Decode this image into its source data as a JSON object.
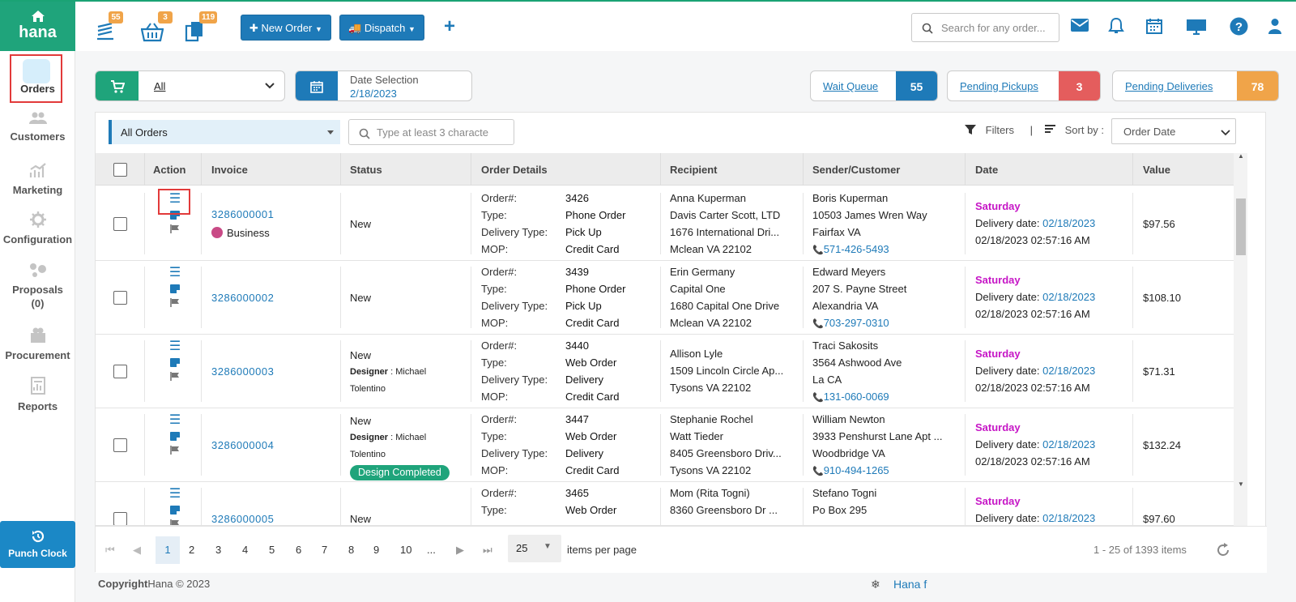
{
  "app": {
    "name": "hana"
  },
  "topbar": {
    "badges": [
      {
        "icon": "stack-icon",
        "count": "55"
      },
      {
        "icon": "basket-icon",
        "count": "3"
      },
      {
        "icon": "copy-icon",
        "count": "119"
      }
    ],
    "new_order": "New Order",
    "dispatch": "Dispatch",
    "search_placeholder": "Search for any order..."
  },
  "sidebar": {
    "items": [
      {
        "label": "Orders",
        "icon": "orders-icon",
        "active": true
      },
      {
        "label": "Customers",
        "icon": "customers-icon"
      },
      {
        "label": "Marketing",
        "icon": "marketing-icon"
      },
      {
        "label": "Configuration",
        "icon": "gear-icon"
      },
      {
        "label": "Proposals",
        "sub": "(0)",
        "icon": "proposals-icon"
      },
      {
        "label": "Procurement",
        "icon": "procurement-icon"
      },
      {
        "label": "Reports",
        "icon": "reports-icon"
      }
    ],
    "punch_clock": "Punch Clock"
  },
  "filters": {
    "store": "All",
    "date_label": "Date Selection",
    "date_value": "2/18/2023",
    "queues": [
      {
        "label": "Wait Queue",
        "count": "55",
        "color": "#1e7ab8"
      },
      {
        "label": "Pending Pickups",
        "count": "3",
        "color": "#e45d5d"
      },
      {
        "label": "Pending Deliveries",
        "count": "78",
        "color": "#f0a449"
      }
    ]
  },
  "grid": {
    "order_filter": "All Orders",
    "search_placeholder": "Type at least 3 characte",
    "filters_label": "Filters",
    "sort_label": "Sort by :",
    "sort_value": "Order Date",
    "columns": [
      "Action",
      "Invoice",
      "Status",
      "Order Details",
      "Recipient",
      "Sender/Customer",
      "Date",
      "Value"
    ],
    "detail_labels": [
      "Order#:",
      "Type:",
      "Delivery Type:",
      "MOP:"
    ],
    "rows": [
      {
        "invoice": "3286000001",
        "tag": "Business",
        "status": "New",
        "designer": "",
        "design_done": "",
        "order_no": "3426",
        "type": "Phone Order",
        "delivery_type": "Pick Up",
        "mop": "Credit Card",
        "recipient": [
          "Anna Kuperman",
          "Davis Carter Scott, LTD",
          "1676 International Dri...",
          "Mclean VA 22102"
        ],
        "sender": [
          "Boris Kuperman",
          "10503 James Wren Way",
          "Fairfax VA"
        ],
        "phone": "571-426-5493",
        "day": "Saturday",
        "delivery_label": "Delivery date:",
        "delivery_date": "02/18/2023",
        "timestamp": "02/18/2023 02:57:16 AM",
        "value": "$97.56"
      },
      {
        "invoice": "3286000002",
        "tag": "",
        "status": "New",
        "designer": "",
        "design_done": "",
        "order_no": "3439",
        "type": "Phone Order",
        "delivery_type": "Pick Up",
        "mop": "Credit Card",
        "recipient": [
          "Erin Germany",
          "Capital One",
          "1680 Capital One Drive",
          "Mclean VA 22102"
        ],
        "sender": [
          "Edward Meyers",
          "207 S. Payne Street",
          "Alexandria VA"
        ],
        "phone": "703-297-0310",
        "day": "Saturday",
        "delivery_label": "Delivery date:",
        "delivery_date": "02/18/2023",
        "timestamp": "02/18/2023 02:57:16 AM",
        "value": "$108.10"
      },
      {
        "invoice": "3286000003",
        "tag": "",
        "status": "New",
        "designer_label": "Designer",
        "designer": "Michael",
        "designer2": "Tolentino",
        "design_done": "",
        "order_no": "3440",
        "type": "Web Order",
        "delivery_type": "Delivery",
        "mop": "Credit Card",
        "recipient": [
          "Allison Lyle",
          "1509 Lincoln Circle Ap...",
          "Tysons VA 22102",
          ""
        ],
        "sender": [
          "Traci Sakosits",
          "3564 Ashwood Ave",
          "La CA"
        ],
        "phone": "131-060-0069",
        "day": "Saturday",
        "delivery_label": "Delivery date:",
        "delivery_date": "02/18/2023",
        "timestamp": "02/18/2023 02:57:16 AM",
        "value": "$71.31"
      },
      {
        "invoice": "3286000004",
        "tag": "",
        "status": "New",
        "designer_label": "Designer",
        "designer": "Michael",
        "designer2": "Tolentino",
        "design_done": "Design Completed",
        "order_no": "3447",
        "type": "Web Order",
        "delivery_type": "Delivery",
        "mop": "Credit Card",
        "recipient": [
          "Stephanie Rochel",
          "Watt Tieder",
          "8405 Greensboro Driv...",
          "Tysons VA 22102"
        ],
        "sender": [
          "William Newton",
          "3933 Penshurst Lane Apt ...",
          "Woodbridge VA"
        ],
        "phone": "910-494-1265",
        "day": "Saturday",
        "delivery_label": "Delivery date:",
        "delivery_date": "02/18/2023",
        "timestamp": "02/18/2023 02:57:16 AM",
        "value": "$132.24"
      },
      {
        "invoice": "3286000005",
        "tag": "",
        "status": "New",
        "designer": "",
        "design_done": "",
        "order_no": "3465",
        "type": "Web Order",
        "delivery_type": "",
        "mop": "",
        "recipient": [
          "Mom (Rita Togni)",
          "8360 Greensboro Dr ...",
          "",
          ""
        ],
        "sender": [
          "Stefano Togni",
          "Po Box 295",
          ""
        ],
        "phone": "",
        "day": "Saturday",
        "delivery_label": "Delivery date:",
        "delivery_date": "02/18/2023",
        "timestamp": "",
        "value": "$97.60"
      }
    ],
    "pages": [
      "1",
      "2",
      "3",
      "4",
      "5",
      "6",
      "7",
      "8",
      "9",
      "10",
      "..."
    ],
    "current_page": "1",
    "per_page": "25",
    "per_page_label": "items per page",
    "summary": "1 - 25 of 1393 items"
  },
  "footer": {
    "copyright_bold": "Copyright",
    "copyright": "Hana © 2023",
    "link": "Hana f"
  }
}
